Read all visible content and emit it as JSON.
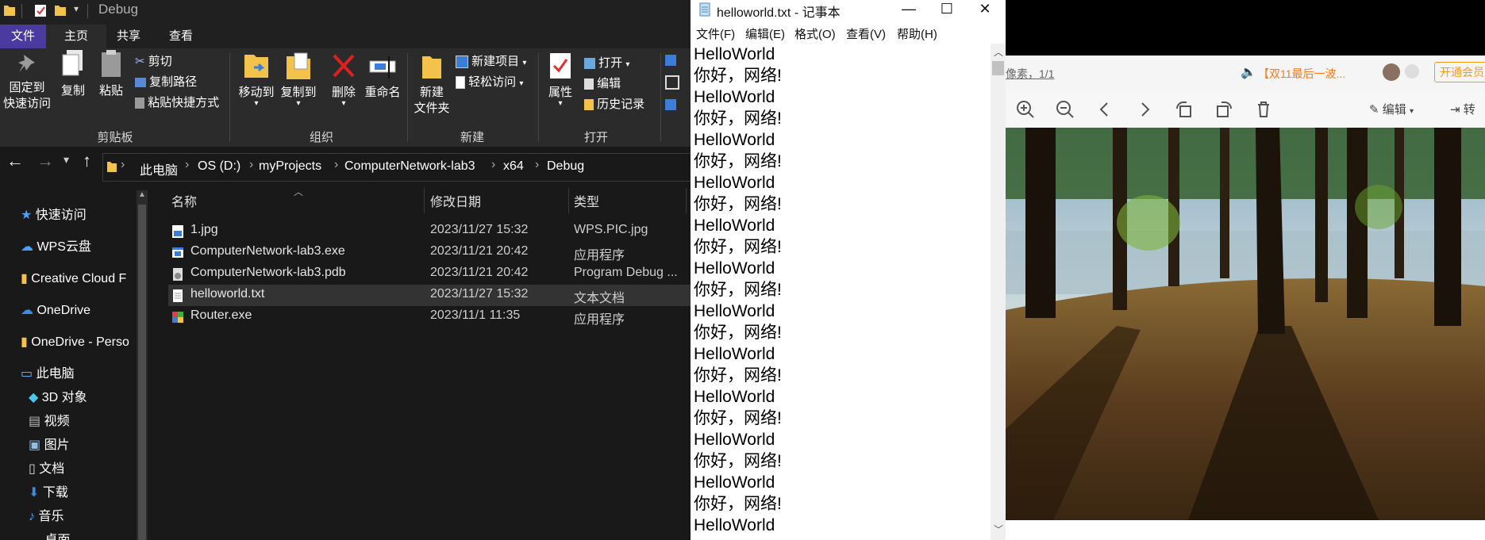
{
  "explorer": {
    "window_title": "Debug",
    "tabs": [
      "文件",
      "主页",
      "共享",
      "查看"
    ],
    "ribbon": {
      "pin_label": "固定到\n快速访问",
      "copy_label": "复制",
      "paste_label": "粘贴",
      "cut_label": "剪切",
      "copy_path_label": "复制路径",
      "paste_shortcut_label": "粘贴快捷方式",
      "clipboard_group": "剪贴板",
      "move_to_label": "移动到",
      "copy_to_label": "复制到",
      "delete_label": "删除",
      "rename_label": "重命名",
      "organize_group": "组织",
      "new_folder_label": "新建\n文件夹",
      "new_item_label": "新建项目",
      "easy_access_label": "轻松访问",
      "new_group": "新建",
      "properties_label": "属性",
      "open_label": "打开",
      "edit_label": "编辑",
      "history_label": "历史记录",
      "open_group": "打开"
    },
    "breadcrumb": [
      "此电脑",
      "OS (D:)",
      "myProjects",
      "ComputerNetwork-lab3",
      "x64",
      "Debug"
    ],
    "nav": {
      "quick_access": "快速访问",
      "wps_cloud": "WPS云盘",
      "creative_cloud": "Creative Cloud F",
      "onedrive": "OneDrive",
      "onedrive_personal": "OneDrive - Perso",
      "this_pc": "此电脑",
      "objects_3d": "3D 对象",
      "videos": "视频",
      "pictures": "图片",
      "documents": "文档",
      "downloads": "下载",
      "music": "音乐",
      "desktop": "桌面"
    },
    "columns": {
      "name": "名称",
      "date": "修改日期",
      "type": "类型"
    },
    "files": [
      {
        "name": "1.jpg",
        "date": "2023/11/27 15:32",
        "type": "WPS.PIC.jpg"
      },
      {
        "name": "ComputerNetwork-lab3.exe",
        "date": "2023/11/21 20:42",
        "type": "应用程序"
      },
      {
        "name": "ComputerNetwork-lab3.pdb",
        "date": "2023/11/21 20:42",
        "type": "Program Debug ..."
      },
      {
        "name": "helloworld.txt",
        "date": "2023/11/27 15:32",
        "type": "文本文档"
      },
      {
        "name": "Router.exe",
        "date": "2023/11/1 11:35",
        "type": "应用程序"
      }
    ]
  },
  "notepad": {
    "title": "helloworld.txt - 记事本",
    "menu": [
      "文件(F)",
      "编辑(E)",
      "格式(O)",
      "查看(V)",
      "帮助(H)"
    ],
    "lines": [
      "HelloWorld",
      "你好，网络!",
      "HelloWorld",
      "你好，网络!",
      "HelloWorld",
      "你好，网络!",
      "HelloWorld",
      "你好，网络!",
      "HelloWorld",
      "你好，网络!",
      "HelloWorld",
      "你好，网络!",
      "HelloWorld",
      "你好，网络!",
      "HelloWorld",
      "你好，网络!",
      "HelloWorld",
      "你好，网络!",
      "HelloWorld",
      "你好，网络!",
      "HelloWorld",
      "你好，网络!",
      "HelloWorld"
    ]
  },
  "viewer": {
    "info_text": "像素，1/1",
    "ad_text": "【双11最后一波...",
    "vip_label": "开通会员",
    "edit_label": "编辑",
    "convert_label": "转"
  },
  "colors": {
    "accent": "#4b3aa0",
    "folder": "#f3c24a",
    "ad_orange": "#ff7a1a",
    "vip_orange": "#f39a1e"
  }
}
